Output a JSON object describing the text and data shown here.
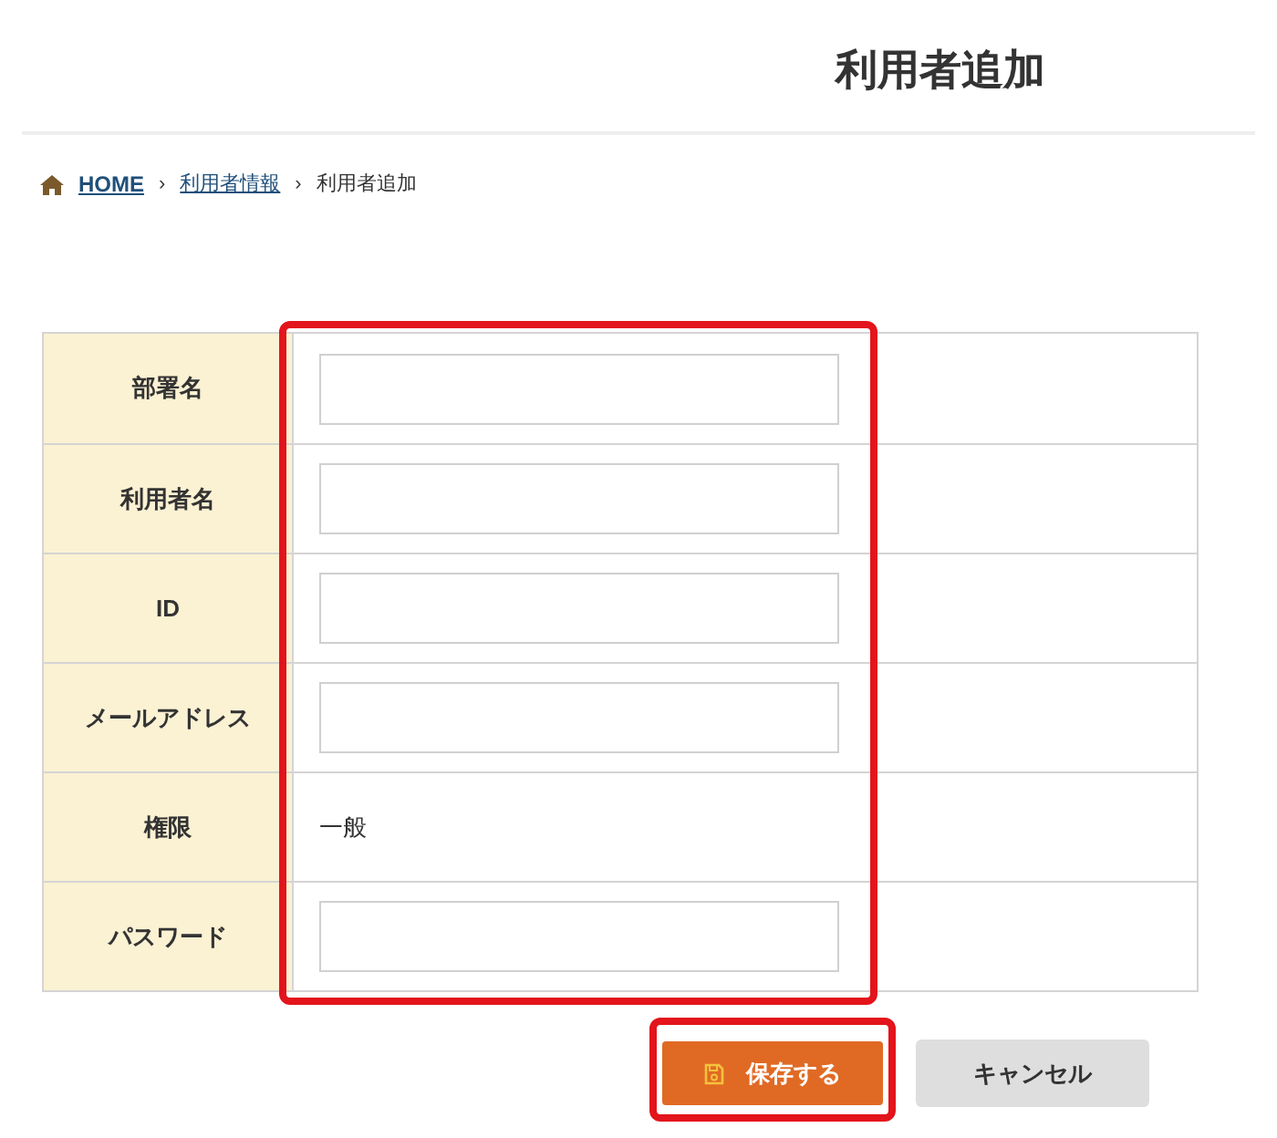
{
  "page_title": "利用者追加",
  "breadcrumb": [
    {
      "label": "HOME",
      "kind": "home"
    },
    {
      "label": "›",
      "kind": "separator"
    },
    {
      "label": "利用者情報",
      "kind": "link"
    },
    {
      "label": "›",
      "kind": "separator"
    },
    {
      "label": "利用者追加",
      "kind": "current"
    }
  ],
  "form_rows": [
    {
      "label": "部署名",
      "kind": "input"
    },
    {
      "label": "利用者名",
      "kind": "input"
    },
    {
      "label": "ID",
      "kind": "input"
    },
    {
      "label": "メールアドレス",
      "kind": "input"
    },
    {
      "label": "権限",
      "kind": "text",
      "value": "一般"
    },
    {
      "label": "パスワード",
      "kind": "input"
    }
  ],
  "buttons": [
    {
      "label": "保存する",
      "kind": "primary"
    },
    {
      "label": "キャンセル",
      "kind": "secondary"
    }
  ]
}
